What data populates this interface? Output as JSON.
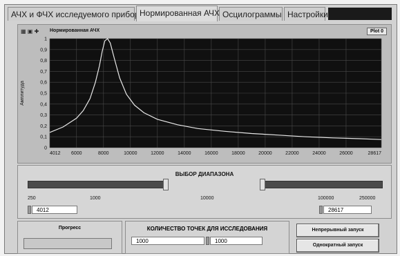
{
  "tabs": [
    {
      "label": "АЧХ и ФЧХ исследуемого прибора"
    },
    {
      "label": "Нормированная АЧХ"
    },
    {
      "label": "Осцилограммы"
    },
    {
      "label": "Настройки"
    }
  ],
  "graph": {
    "title": "Нормированная АЧХ",
    "plot_badge": "Plot 0",
    "colors": {
      "background": "#101010",
      "grid": "#4a4a4a",
      "curve": "#e8e8e8"
    }
  },
  "chart_data": {
    "type": "line",
    "title": "Нормированная АЧХ",
    "xlabel": "",
    "ylabel": "Амплитуда",
    "xlim": [
      4012,
      28617
    ],
    "ylim": [
      0,
      1
    ],
    "x_ticks": [
      "4012",
      "6000",
      "8000",
      "10000",
      "12000",
      "14000",
      "16000",
      "18000",
      "20000",
      "22000",
      "24000",
      "26000",
      "28617"
    ],
    "y_ticks": [
      "0",
      "0,1",
      "0,2",
      "0,3",
      "0,4",
      "0,5",
      "0,6",
      "0,7",
      "0,8",
      "0,9",
      "1"
    ],
    "grid": true,
    "series": [
      {
        "x": [
          4012,
          5000,
          6000,
          6500,
          7000,
          7400,
          7700,
          7900,
          8100,
          8300,
          8500,
          8800,
          9200,
          9700,
          10300,
          11000,
          12000,
          13500,
          15000,
          17000,
          19000,
          21000,
          23000,
          25000,
          27000,
          28617
        ],
        "y": [
          0.14,
          0.19,
          0.27,
          0.34,
          0.45,
          0.6,
          0.75,
          0.88,
          0.98,
          1.0,
          0.96,
          0.82,
          0.64,
          0.49,
          0.39,
          0.32,
          0.26,
          0.21,
          0.175,
          0.15,
          0.13,
          0.115,
          0.1,
          0.09,
          0.082,
          0.075
        ]
      }
    ]
  },
  "range": {
    "title": "ВЫБОР ДИАПАЗОНА",
    "left_scale": [
      "250",
      "1000",
      "10000"
    ],
    "right_scale": [
      "100000",
      "250000"
    ],
    "min_value": "4012",
    "max_value": "28617"
  },
  "progress": {
    "label": "Прогресс",
    "value": 0
  },
  "points": {
    "label": "КОЛИЧЕСТВО ТОЧЕК ДЛЯ ИССЛЕДОВАНИЯ",
    "selected": "1000",
    "value": "1000"
  },
  "buttons": {
    "continuous": "Непрерывный запуск",
    "single": "Однократный запуск"
  }
}
